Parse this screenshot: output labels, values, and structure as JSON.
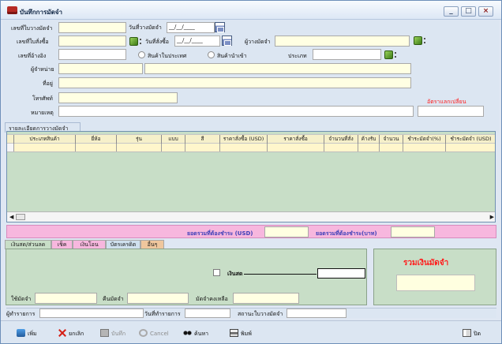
{
  "window": {
    "title": "บันทึกการมัดจำ",
    "controls": [
      "_",
      "□",
      "×"
    ]
  },
  "form": {
    "deposit_no_label": "เลขที่ใบวางมัดจำ",
    "deposit_date_label": "วันที่วางมัดจำ",
    "deposit_date_value": "__/__/____",
    "po_no_label": "เลขที่ใบสั่งซื้อ",
    "po_date_label": "วันที่สั่งซื้อ",
    "po_date_value": "__/__/____",
    "depositor_label": "ผู้วางมัดจำ",
    "ref_no_label": "เลขที่อ้างอิง",
    "domestic_label": "สินค้าในประเทศ",
    "import_label": "สินค้านำเข้า",
    "type_label": "ประเภท",
    "seller_label": "ผู้จำหน่าย",
    "address_label": "ที่อยู่",
    "phone_label": "โทรศัพท์",
    "note_label": "หมายเหตุ",
    "exchange_rate_label": "อัตราแลกเปลี่ยน"
  },
  "details": {
    "tab_label": "รายละเอียดการวางมัดจำ",
    "columns": [
      "ประเภทสินค้า",
      "ยี่ห้อ",
      "รุ่น",
      "แบบ",
      "สี",
      "ราคาสั่งซื้อ (USD)",
      "ราคาสั่งซื้อ",
      "จำนวนที่สั่ง",
      "ค้างรับ",
      "จำนวน",
      "ชำระมัดจำ(%)",
      "ชำระมัดจำ (USD)"
    ]
  },
  "totals": {
    "usd_label": "ยอดรวมที่ต้องชำระ (USD)",
    "baht_label": "ยอดรวมที่ต้องชำระ(บาท)"
  },
  "payment": {
    "tabs": [
      "เงินสด/ส่วนลด",
      "เช็ค",
      "เงินโอน",
      "บัตรเครดิต",
      "อื่นๆ"
    ],
    "cash_label": "เงินสด",
    "use_deposit_label": "ใช้มัดจำ",
    "refund_deposit_label": "คืนมัดจำ",
    "remaining_deposit_label": "มัดจำคงเหลือ"
  },
  "summary": {
    "title": "รวมเงินมัดจำ"
  },
  "status": {
    "maker_label": "ผู้ทำรายการ",
    "date_label": "วันที่ทำรายการ",
    "status_label": "สถานะใบวางมัดจำ"
  },
  "toolbar": {
    "add": "เพิ่ม",
    "cancel_item": "ยกเลิก",
    "save": "บันทึก",
    "cancel": "Cancel",
    "search": "ค้นหา",
    "print": "พิมพ์",
    "close": "ปิด"
  },
  "colors": {
    "accent_red": "#ff1c1c",
    "grid_green": "#c8dec7",
    "total_pink": "#f7b7de",
    "field_yellow": "#ffffe3"
  }
}
